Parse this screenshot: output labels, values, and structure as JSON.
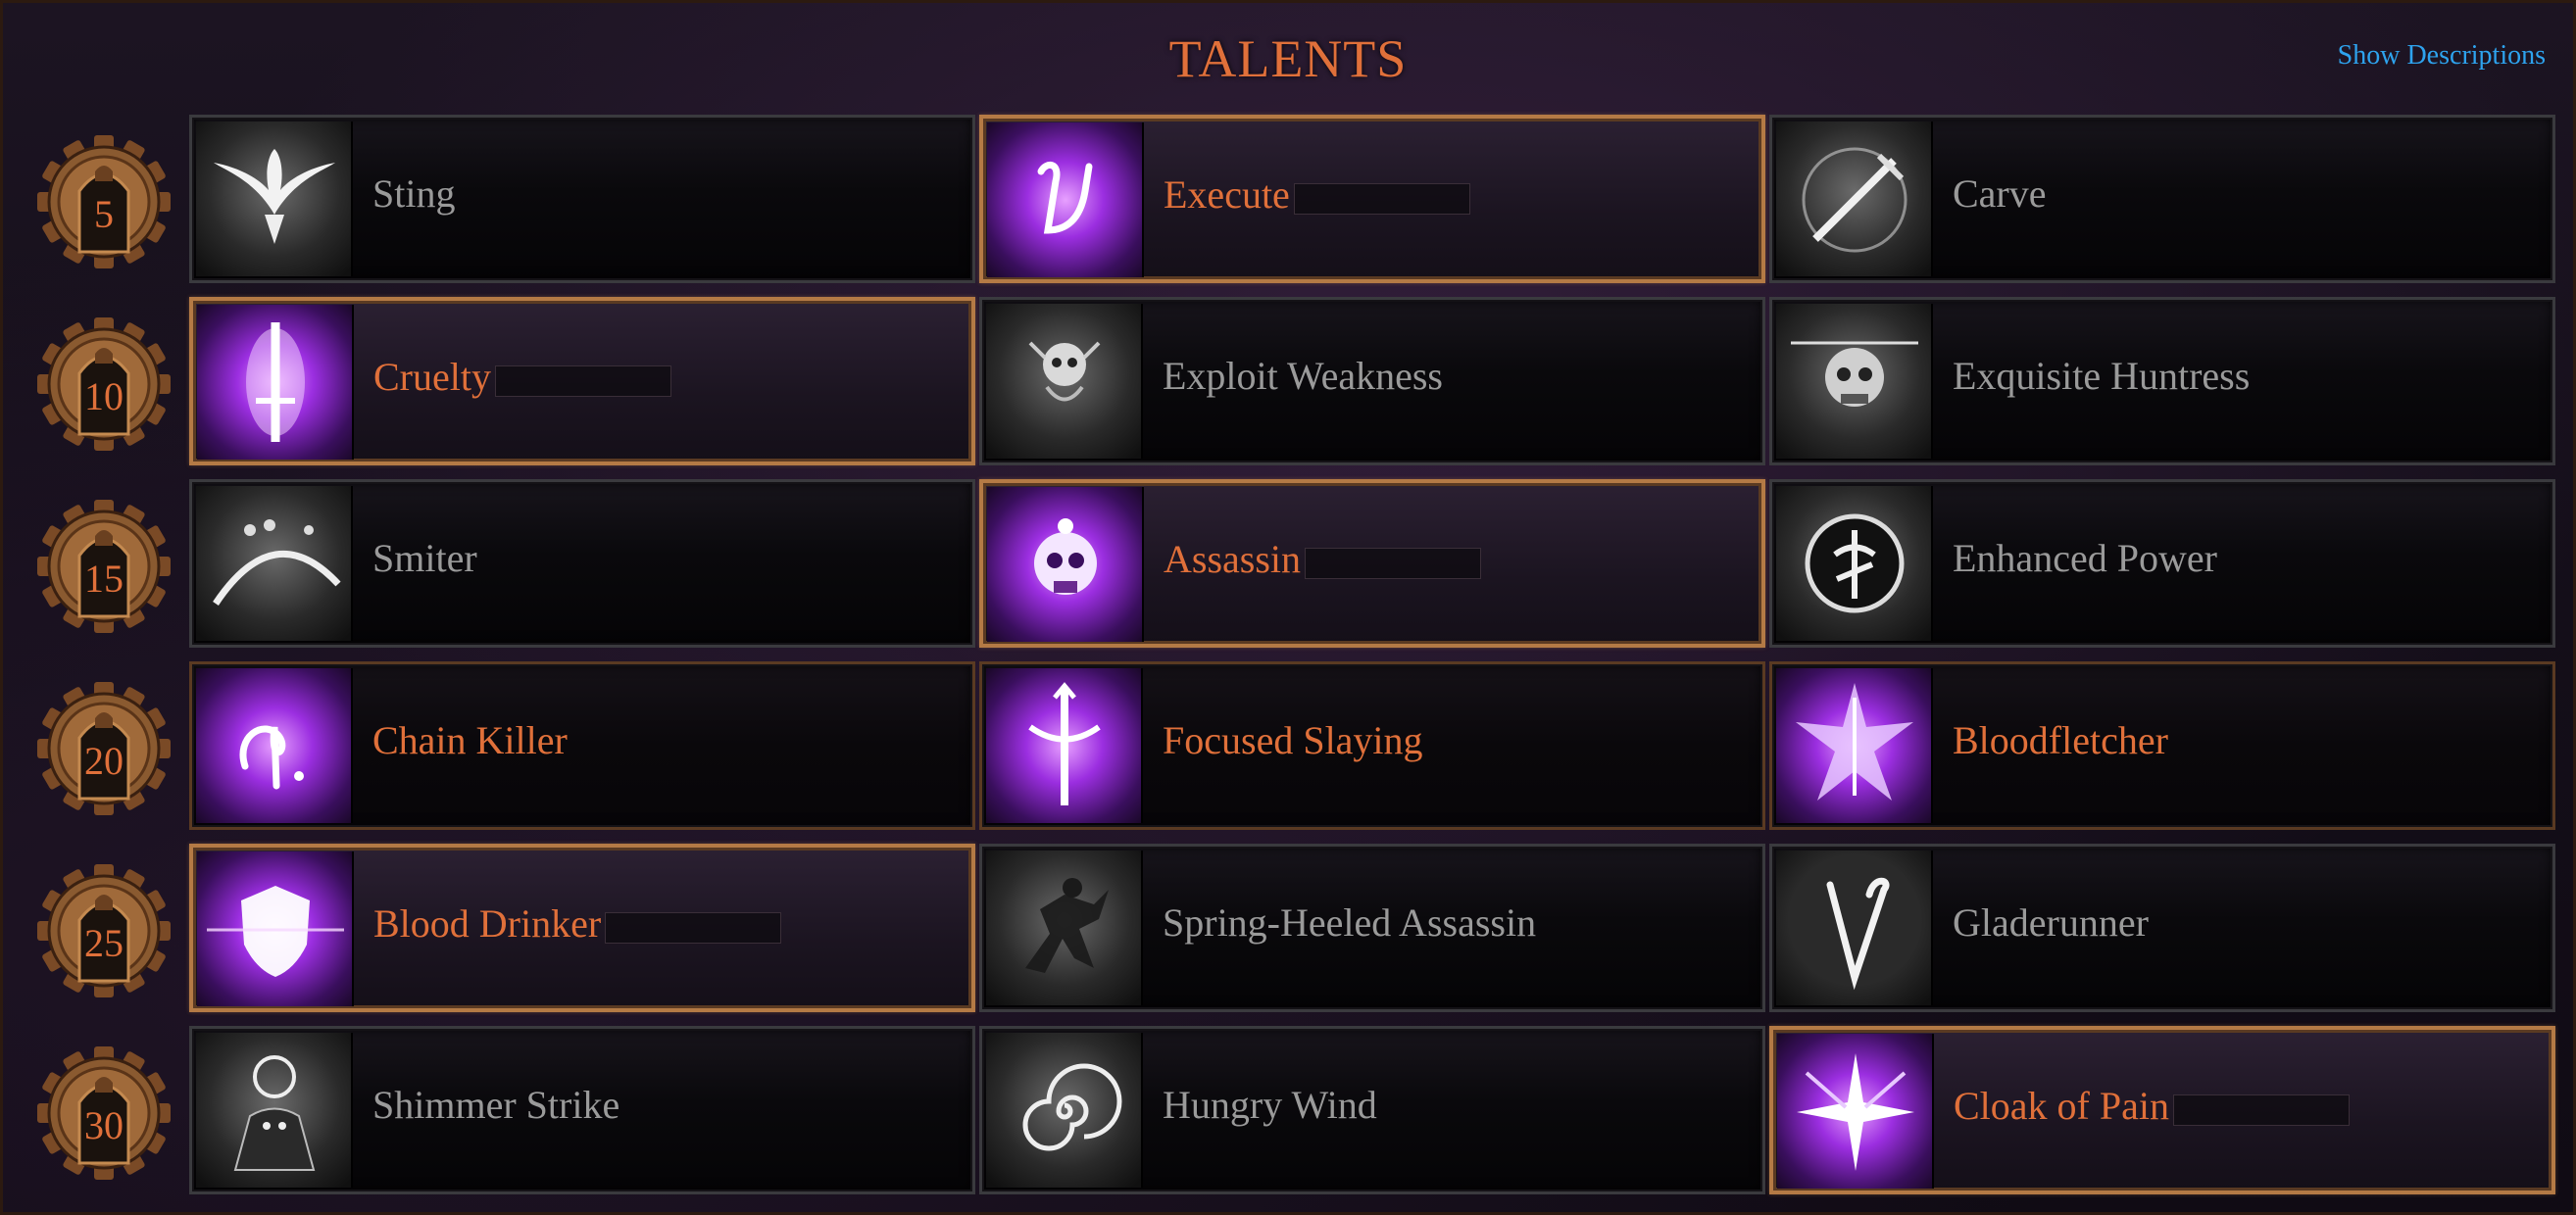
{
  "header": {
    "title": "TALENTS",
    "show_descriptions": "Show Descriptions"
  },
  "colors": {
    "accent_orange": "#e0703a",
    "link_blue": "#2ea3ee",
    "locked_grey": "#9a9a9a",
    "chosen_border": "#b47a45",
    "purple_glow": "#c040ff"
  },
  "rows": [
    {
      "level": "5",
      "talents": [
        {
          "name": "Sting",
          "icon": "dove-icon",
          "state": "locked"
        },
        {
          "name": "Execute",
          "icon": "execute-rune-icon",
          "state": "chosen"
        },
        {
          "name": "Carve",
          "icon": "sword-slash-icon",
          "state": "locked"
        }
      ]
    },
    {
      "level": "10",
      "talents": [
        {
          "name": "Cruelty",
          "icon": "cruelty-dagger-icon",
          "state": "chosen"
        },
        {
          "name": "Exploit Weakness",
          "icon": "skull-cloak-icon",
          "state": "locked"
        },
        {
          "name": "Exquisite Huntress",
          "icon": "huntress-skull-icon",
          "state": "locked"
        }
      ]
    },
    {
      "level": "15",
      "talents": [
        {
          "name": "Smiter",
          "icon": "smiter-icon",
          "state": "locked"
        },
        {
          "name": "Assassin",
          "icon": "assassin-skull-icon",
          "state": "chosen"
        },
        {
          "name": "Enhanced Power",
          "icon": "power-rune-icon",
          "state": "locked"
        }
      ]
    },
    {
      "level": "20",
      "talents": [
        {
          "name": "Chain Killer",
          "icon": "chain-rune-icon",
          "state": "unlocked"
        },
        {
          "name": "Focused Slaying",
          "icon": "sword-rune-icon",
          "state": "unlocked"
        },
        {
          "name": "Bloodfletcher",
          "icon": "arrow-burst-icon",
          "state": "unlocked"
        }
      ]
    },
    {
      "level": "25",
      "talents": [
        {
          "name": "Blood Drinker",
          "icon": "shield-glow-icon",
          "state": "chosen"
        },
        {
          "name": "Spring-Heeled Assassin",
          "icon": "leaping-assassin-icon",
          "state": "locked"
        },
        {
          "name": "Gladerunner",
          "icon": "glade-rune-icon",
          "state": "locked"
        }
      ]
    },
    {
      "level": "30",
      "talents": [
        {
          "name": "Shimmer Strike",
          "icon": "shimmer-figure-icon",
          "state": "locked"
        },
        {
          "name": "Hungry Wind",
          "icon": "spiral-wind-icon",
          "state": "locked"
        },
        {
          "name": "Cloak of Pain",
          "icon": "cloak-burst-icon",
          "state": "chosen"
        }
      ]
    }
  ]
}
